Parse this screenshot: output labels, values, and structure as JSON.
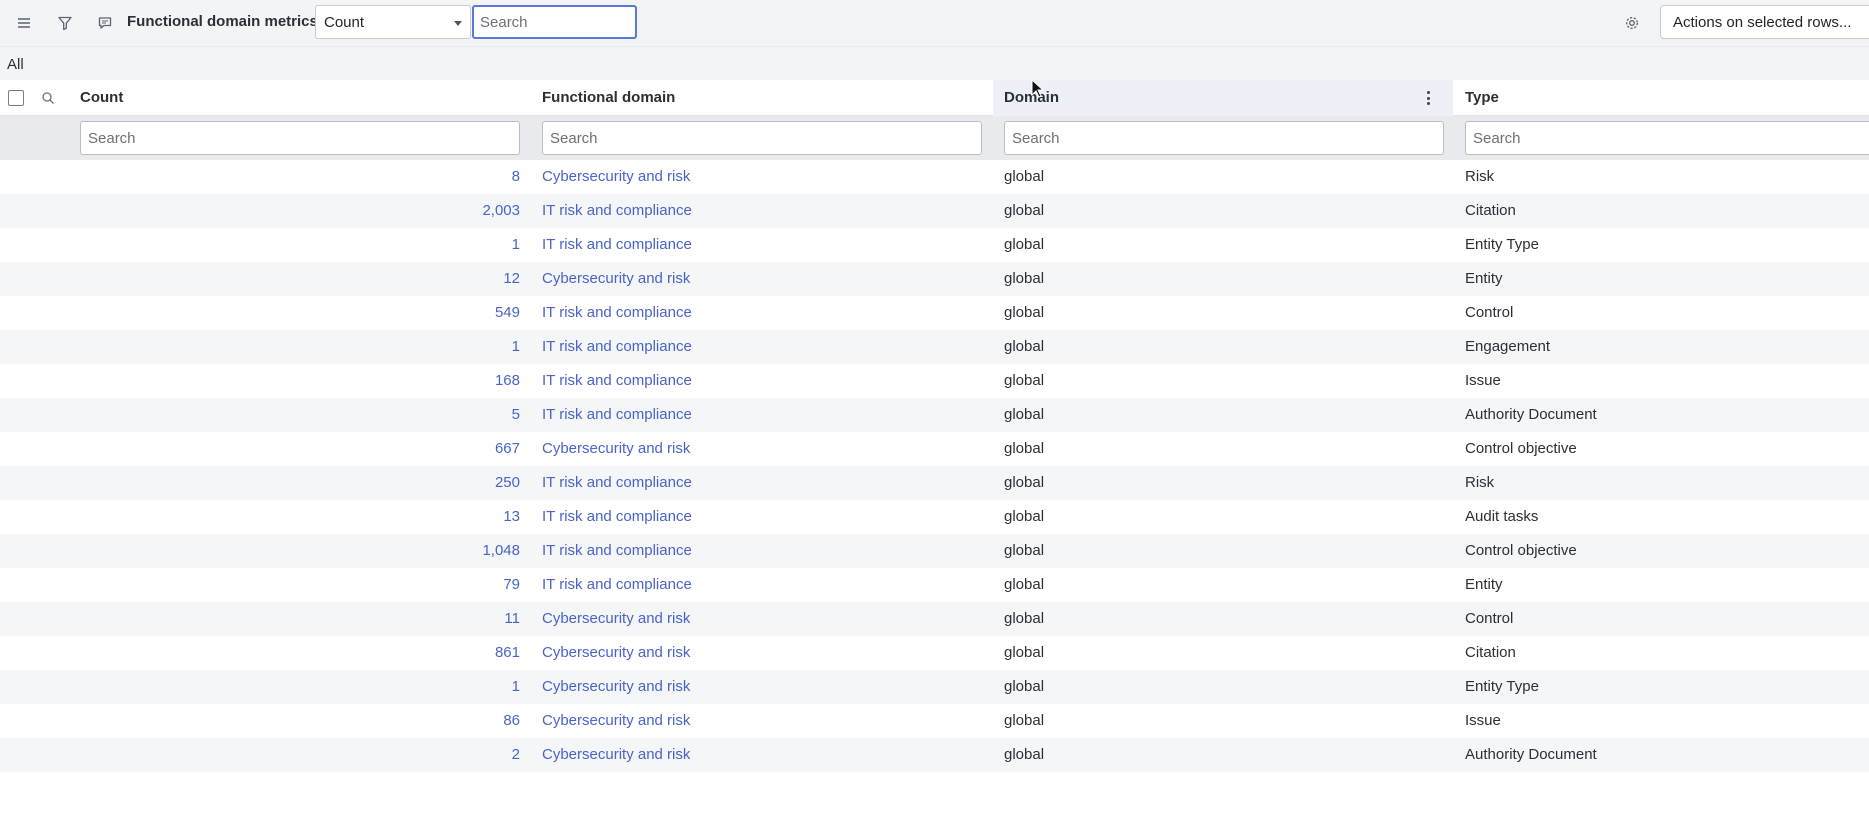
{
  "toolbar": {
    "title": "Functional domain metrics",
    "field_select_value": "Count",
    "search_placeholder": "Search",
    "actions_label": "Actions on selected rows..."
  },
  "breadcrumb": "All",
  "columns": {
    "count": "Count",
    "functional_domain": "Functional domain",
    "domain": "Domain",
    "type": "Type"
  },
  "filters": {
    "count_placeholder": "Search",
    "functional_domain_placeholder": "Search",
    "domain_placeholder": "Search",
    "type_placeholder": "Search"
  },
  "rows": [
    {
      "count": "8",
      "functional_domain": "Cybersecurity and risk",
      "domain": "global",
      "type": "Risk"
    },
    {
      "count": "2,003",
      "functional_domain": "IT risk and compliance",
      "domain": "global",
      "type": "Citation"
    },
    {
      "count": "1",
      "functional_domain": "IT risk and compliance",
      "domain": "global",
      "type": "Entity Type"
    },
    {
      "count": "12",
      "functional_domain": "Cybersecurity and risk",
      "domain": "global",
      "type": "Entity"
    },
    {
      "count": "549",
      "functional_domain": "IT risk and compliance",
      "domain": "global",
      "type": "Control"
    },
    {
      "count": "1",
      "functional_domain": "IT risk and compliance",
      "domain": "global",
      "type": "Engagement"
    },
    {
      "count": "168",
      "functional_domain": "IT risk and compliance",
      "domain": "global",
      "type": "Issue"
    },
    {
      "count": "5",
      "functional_domain": "IT risk and compliance",
      "domain": "global",
      "type": "Authority Document"
    },
    {
      "count": "667",
      "functional_domain": "Cybersecurity and risk",
      "domain": "global",
      "type": "Control objective"
    },
    {
      "count": "250",
      "functional_domain": "IT risk and compliance",
      "domain": "global",
      "type": "Risk"
    },
    {
      "count": "13",
      "functional_domain": "IT risk and compliance",
      "domain": "global",
      "type": "Audit tasks"
    },
    {
      "count": "1,048",
      "functional_domain": "IT risk and compliance",
      "domain": "global",
      "type": "Control objective"
    },
    {
      "count": "79",
      "functional_domain": "IT risk and compliance",
      "domain": "global",
      "type": "Entity"
    },
    {
      "count": "11",
      "functional_domain": "Cybersecurity and risk",
      "domain": "global",
      "type": "Control"
    },
    {
      "count": "861",
      "functional_domain": "Cybersecurity and risk",
      "domain": "global",
      "type": "Citation"
    },
    {
      "count": "1",
      "functional_domain": "Cybersecurity and risk",
      "domain": "global",
      "type": "Entity Type"
    },
    {
      "count": "86",
      "functional_domain": "Cybersecurity and risk",
      "domain": "global",
      "type": "Issue"
    },
    {
      "count": "2",
      "functional_domain": "Cybersecurity and risk",
      "domain": "global",
      "type": "Authority Document"
    }
  ],
  "colors": {
    "link": "#4a63c9",
    "toolbar_bg": "#f3f4f6",
    "search_focus": "#5a7ad8"
  }
}
